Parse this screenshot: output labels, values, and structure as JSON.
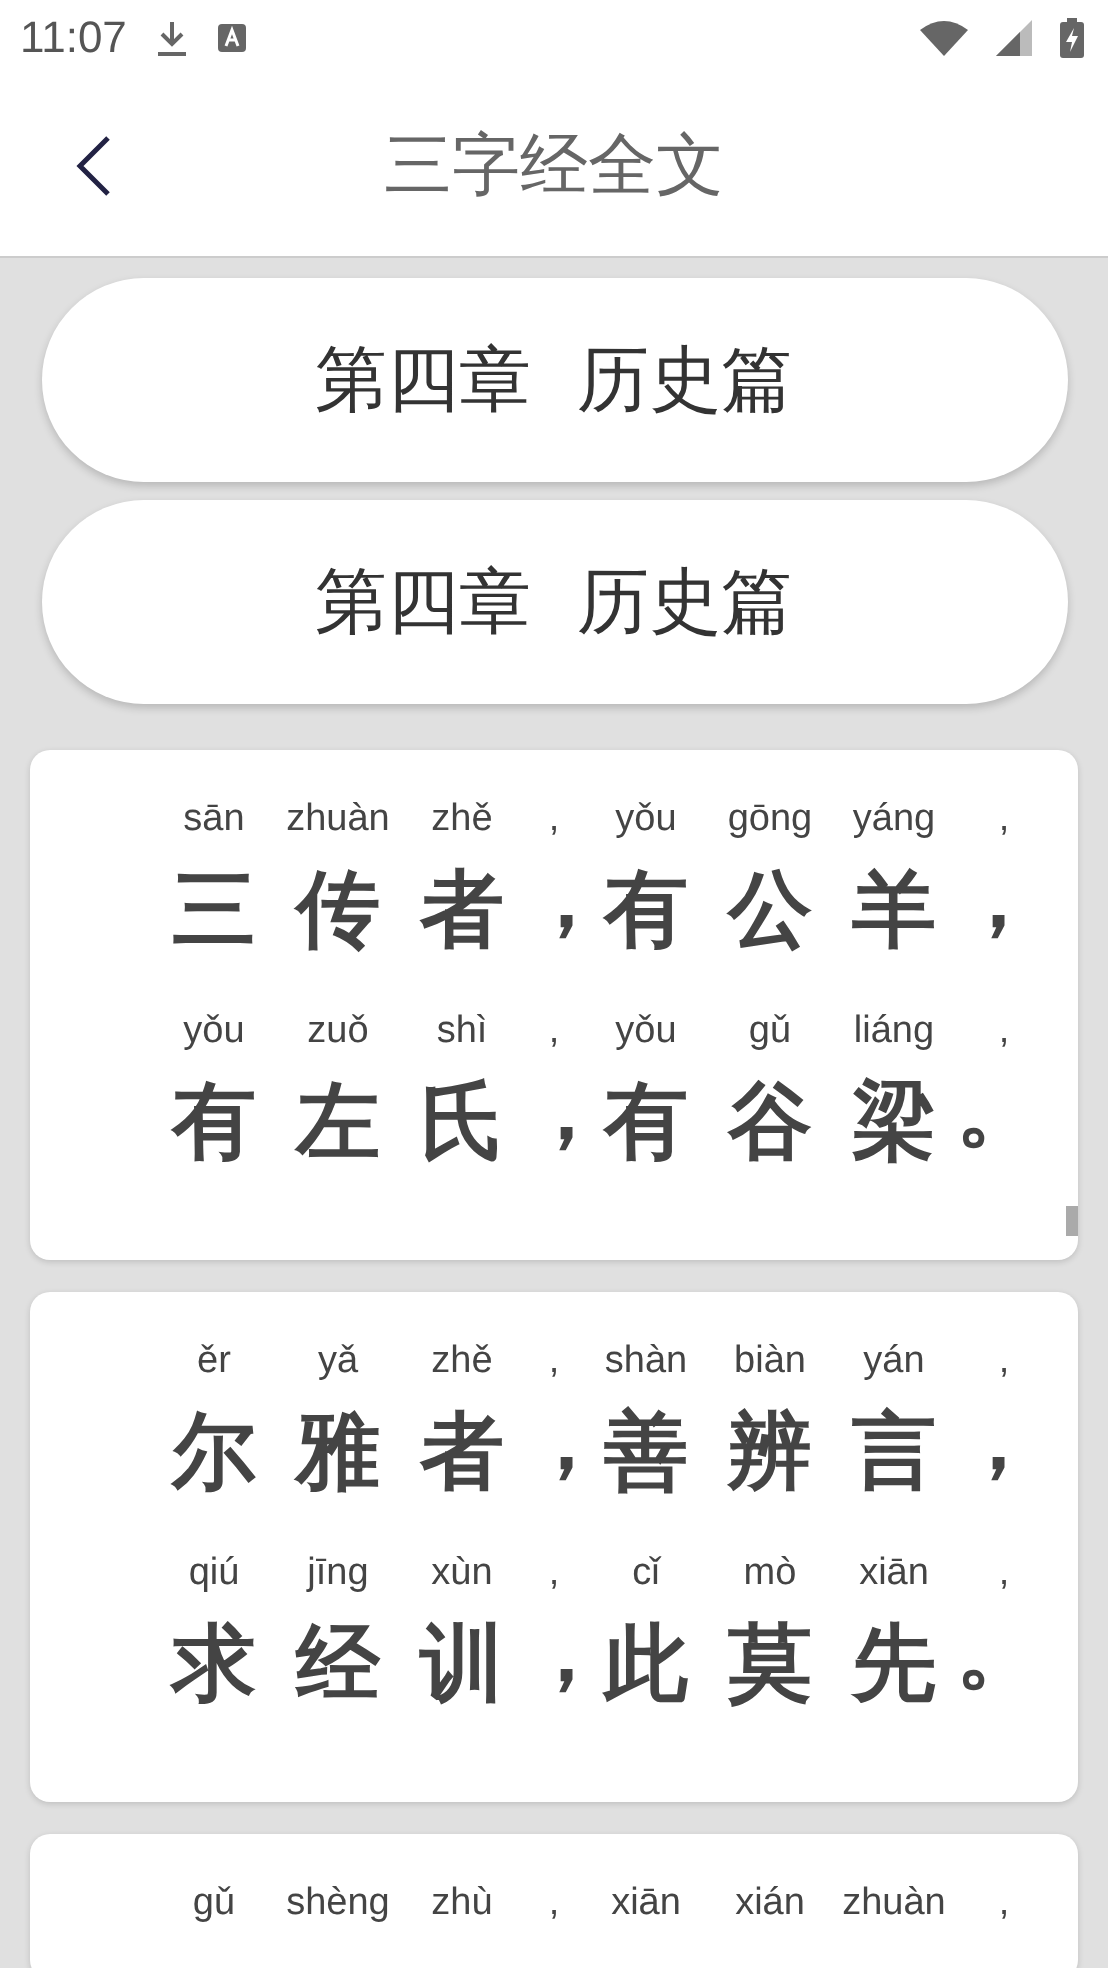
{
  "status_bar": {
    "time": "11:07"
  },
  "header": {
    "title": "三字经全文"
  },
  "chapters": [
    {
      "label": "第四章  历史篇"
    },
    {
      "label": "第四章  历史篇"
    }
  ],
  "verses": [
    {
      "lines": [
        {
          "pinyin": [
            "sān",
            "zhuàn",
            "zhě",
            ",",
            "yǒu",
            "gōng",
            "yáng",
            ","
          ],
          "hanzi": [
            "三",
            "传",
            "者",
            "，",
            "有",
            "公",
            "羊",
            "，"
          ]
        },
        {
          "pinyin": [
            "yǒu",
            "zuǒ",
            "shì",
            ",",
            "yǒu",
            "gǔ",
            "liáng",
            ","
          ],
          "hanzi": [
            "有",
            "左",
            "氏",
            "，",
            "有",
            "谷",
            "梁",
            "。"
          ]
        }
      ]
    },
    {
      "lines": [
        {
          "pinyin": [
            "ěr",
            "yǎ",
            "zhě",
            ",",
            "shàn",
            "biàn",
            "yán",
            ","
          ],
          "hanzi": [
            "尔",
            "雅",
            "者",
            "，",
            "善",
            "辨",
            "言",
            "，"
          ]
        },
        {
          "pinyin": [
            "qiú",
            "jīng",
            "xùn",
            ",",
            "cǐ",
            "mò",
            "xiān",
            ","
          ],
          "hanzi": [
            "求",
            "经",
            "训",
            "，",
            "此",
            "莫",
            "先",
            "。"
          ]
        }
      ]
    },
    {
      "lines": [
        {
          "pinyin": [
            "gǔ",
            "shèng",
            "zhù",
            ",",
            "xiān",
            "xián",
            "zhuàn",
            ","
          ]
        }
      ]
    }
  ]
}
